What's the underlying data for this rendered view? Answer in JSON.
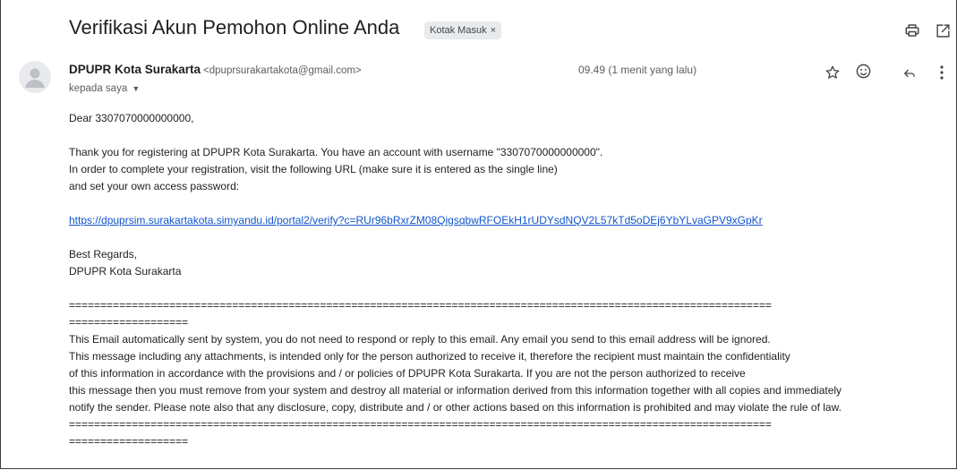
{
  "subject": "Verifikasi Akun Pemohon Online Anda",
  "label": {
    "text": "Kotak Masuk",
    "remove": "×"
  },
  "sender": {
    "name": "DPUPR Kota Surakarta",
    "email": "<dpuprsurakartakota@gmail.com>"
  },
  "recipient": "kepada saya",
  "time": "09.49 (1 menit yang lalu)",
  "icons": {
    "print": "print-icon",
    "open_new_window": "open-in-new-window-icon",
    "avatar": "default-avatar-icon",
    "star": "star-icon",
    "emoji": "emoji-react-icon",
    "reply": "reply-icon",
    "more": "more-vert-icon",
    "dropdown": "dropdown-caret-icon"
  },
  "body": {
    "greeting": "Dear 3307070000000000,",
    "para1_line1": "Thank you for registering at DPUPR Kota Surakarta. You have an account with username \"3307070000000000\".",
    "para1_line2": "In order to complete your registration, visit the following URL (make sure it is entered as the single line)",
    "para1_line3": "and set your own access password:",
    "url": "https://dpuprsim.surakartakota.simyandu.id/portal2/verify?c=RUr96bRxrZM08QigsqbwRFOEkH1rUDYsdNQV2L57kTd5oDEj6YbYLvaGPV9xGpKr",
    "closing1": "Best Regards,",
    "closing2": "DPUPR Kota Surakarta",
    "sep_long": "================================================================================================================",
    "sep_short": "===================",
    "disclaimer1": "This Email automatically sent by system, you do not need to respond or reply to this email. Any email you send to this email address will be ignored.",
    "disclaimer2": "This message including any attachments, is intended only for the person authorized to receive it, therefore the recipient must maintain the confidentiality",
    "disclaimer3": "of this information in accordance with the provisions and / or policies of DPUPR Kota Surakarta. If you are not the person authorized to receive",
    "disclaimer4": "this message then you must remove from your system and destroy all material or information derived from this information together with all copies and immediately",
    "disclaimer5": "notify the sender. Please note also that any disclosure, copy, distribute and / or other actions based on this information is prohibited and may violate the rule of law."
  }
}
